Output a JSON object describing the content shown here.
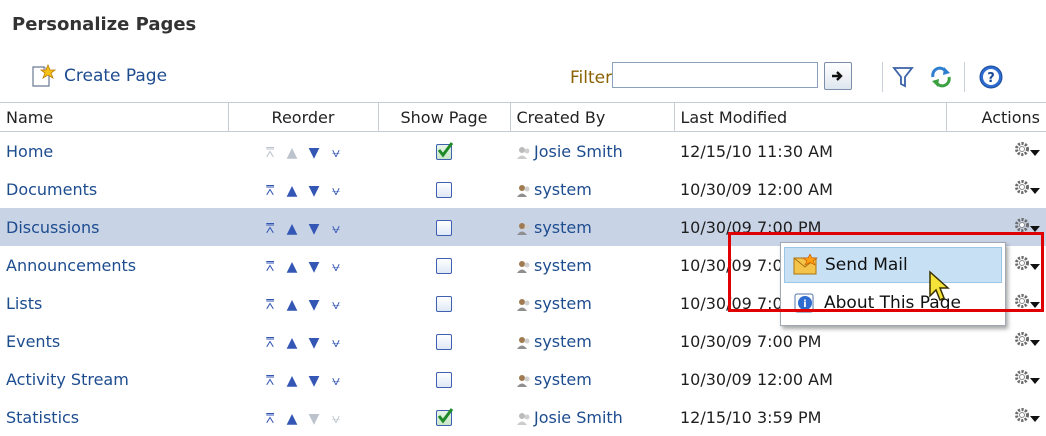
{
  "page": {
    "title": "Personalize Pages"
  },
  "toolbar": {
    "create_label": "Create Page",
    "filter_label": "Filter",
    "filter_value": ""
  },
  "table": {
    "columns": [
      "Name",
      "Reorder",
      "Show Page",
      "Created By",
      "Last Modified",
      "Actions"
    ],
    "rows": [
      {
        "name": "Home",
        "show_page": true,
        "created_by": "Josie Smith",
        "last_modified": "12/15/10 11:30 AM",
        "reorder": {
          "top": false,
          "up": false,
          "down": true,
          "bottom": true
        }
      },
      {
        "name": "Documents",
        "show_page": false,
        "created_by": "system",
        "last_modified": "10/30/09 12:00 AM",
        "reorder": {
          "top": true,
          "up": true,
          "down": true,
          "bottom": true
        }
      },
      {
        "name": "Discussions",
        "show_page": false,
        "created_by": "system",
        "last_modified": "10/30/09 7:00 PM",
        "reorder": {
          "top": true,
          "up": true,
          "down": true,
          "bottom": true
        }
      },
      {
        "name": "Announcements",
        "show_page": false,
        "created_by": "system",
        "last_modified": "10/30/09 7:00 PM",
        "reorder": {
          "top": true,
          "up": true,
          "down": true,
          "bottom": true
        }
      },
      {
        "name": "Lists",
        "show_page": false,
        "created_by": "system",
        "last_modified": "10/30/09 7:00 PM",
        "reorder": {
          "top": true,
          "up": true,
          "down": true,
          "bottom": true
        }
      },
      {
        "name": "Events",
        "show_page": false,
        "created_by": "system",
        "last_modified": "10/30/09 7:00 PM",
        "reorder": {
          "top": true,
          "up": true,
          "down": true,
          "bottom": true
        }
      },
      {
        "name": "Activity Stream",
        "show_page": false,
        "created_by": "system",
        "last_modified": "10/30/09 12:00 AM",
        "reorder": {
          "top": true,
          "up": true,
          "down": true,
          "bottom": true
        }
      },
      {
        "name": "Statistics",
        "show_page": true,
        "created_by": "Josie Smith",
        "last_modified": "12/15/10 3:59 PM",
        "reorder": {
          "top": true,
          "up": true,
          "down": false,
          "bottom": false
        }
      }
    ],
    "selected_row": "Discussions"
  },
  "context_menu": {
    "items": [
      {
        "label": "Send Mail",
        "icon": "mail-icon",
        "highlighted": true
      },
      {
        "label": "About This Page",
        "icon": "info-icon",
        "highlighted": false
      }
    ]
  },
  "colors": {
    "link": "#1d4c8f",
    "selected_row": "#c9d3e6",
    "annotation": "#e00000",
    "filter_label": "#8a6300"
  }
}
